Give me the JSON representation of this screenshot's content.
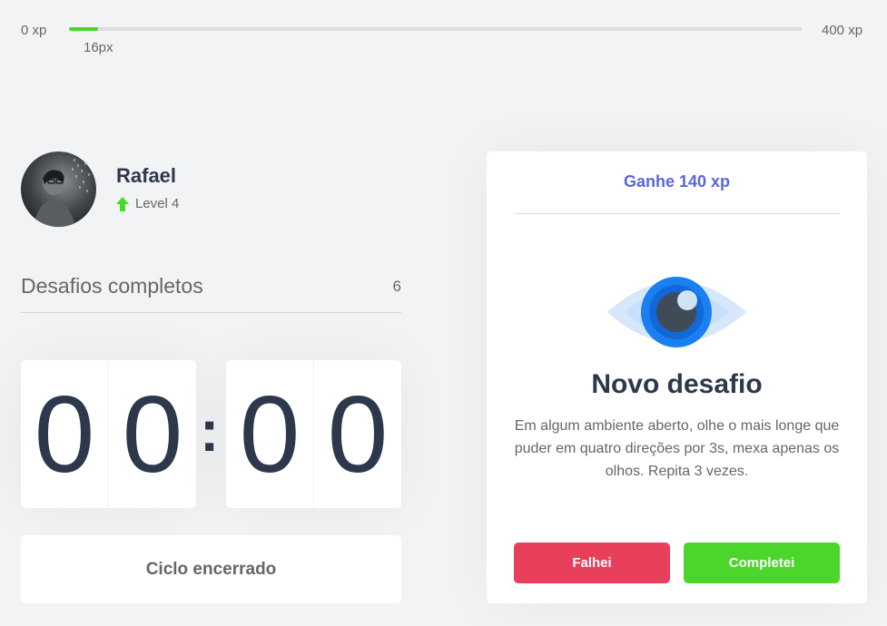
{
  "xp_bar": {
    "min_label": "0 xp",
    "max_label": "400 xp",
    "current_label": "16px",
    "progress_fraction": 0.04,
    "fill_color": "#4cd62b"
  },
  "profile": {
    "name": "Rafael",
    "level_label": "Level 4",
    "level_icon": "arrow-up-icon"
  },
  "completed_challenges": {
    "label": "Desafios completos",
    "count": "6"
  },
  "countdown": {
    "minute_left": "0",
    "minute_right": "0",
    "separator": ":",
    "second_left": "0",
    "second_right": "0"
  },
  "cycle_button": {
    "label": "Ciclo encerrado"
  },
  "challenge_card": {
    "header": "Ganhe 140 xp",
    "icon": "eye-icon",
    "title": "Novo desafio",
    "description": "Em algum ambiente aberto, olhe o mais longe que puder em quatro direções por 3s, mexa apenas os olhos. Repita 3 vezes.",
    "fail_label": "Falhei",
    "complete_label": "Completei"
  },
  "colors": {
    "background": "#f2f3f5",
    "accent_blue": "#5965e0",
    "green": "#4cd62b",
    "red": "#e83f5b",
    "title": "#2e384d",
    "text": "#666666"
  }
}
